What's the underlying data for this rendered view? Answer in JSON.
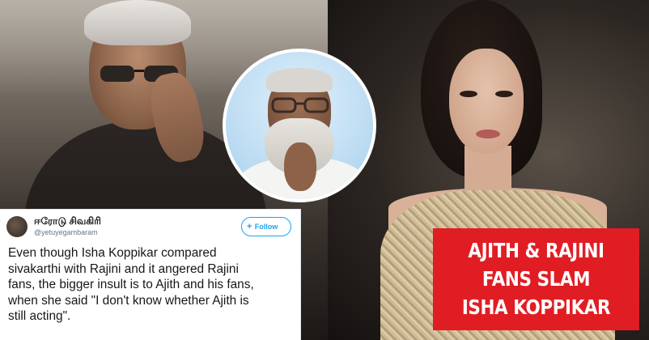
{
  "tweet": {
    "author_name": "ஈரோடு சிவகிரி",
    "author_handle": "@yetuyegambaram",
    "follow_label": "Follow",
    "text": "Even though Isha Koppikar compared\nsivakarthi with Rajini and it angered Rajini\nfans, the bigger insult is to Ajith and his fans,\nwhen she said \"I don't know whether Ajith is\nstill acting\"."
  },
  "headline": {
    "lines": [
      "AJITH & RAJINI",
      "FANS SLAM",
      "ISHA KOPPIKAR"
    ]
  },
  "colors": {
    "headline_bg": "#e11d24",
    "headline_text": "#ffffff",
    "twitter_blue": "#1da1f2"
  },
  "icons": {
    "follow_plus": "add-user-icon"
  }
}
